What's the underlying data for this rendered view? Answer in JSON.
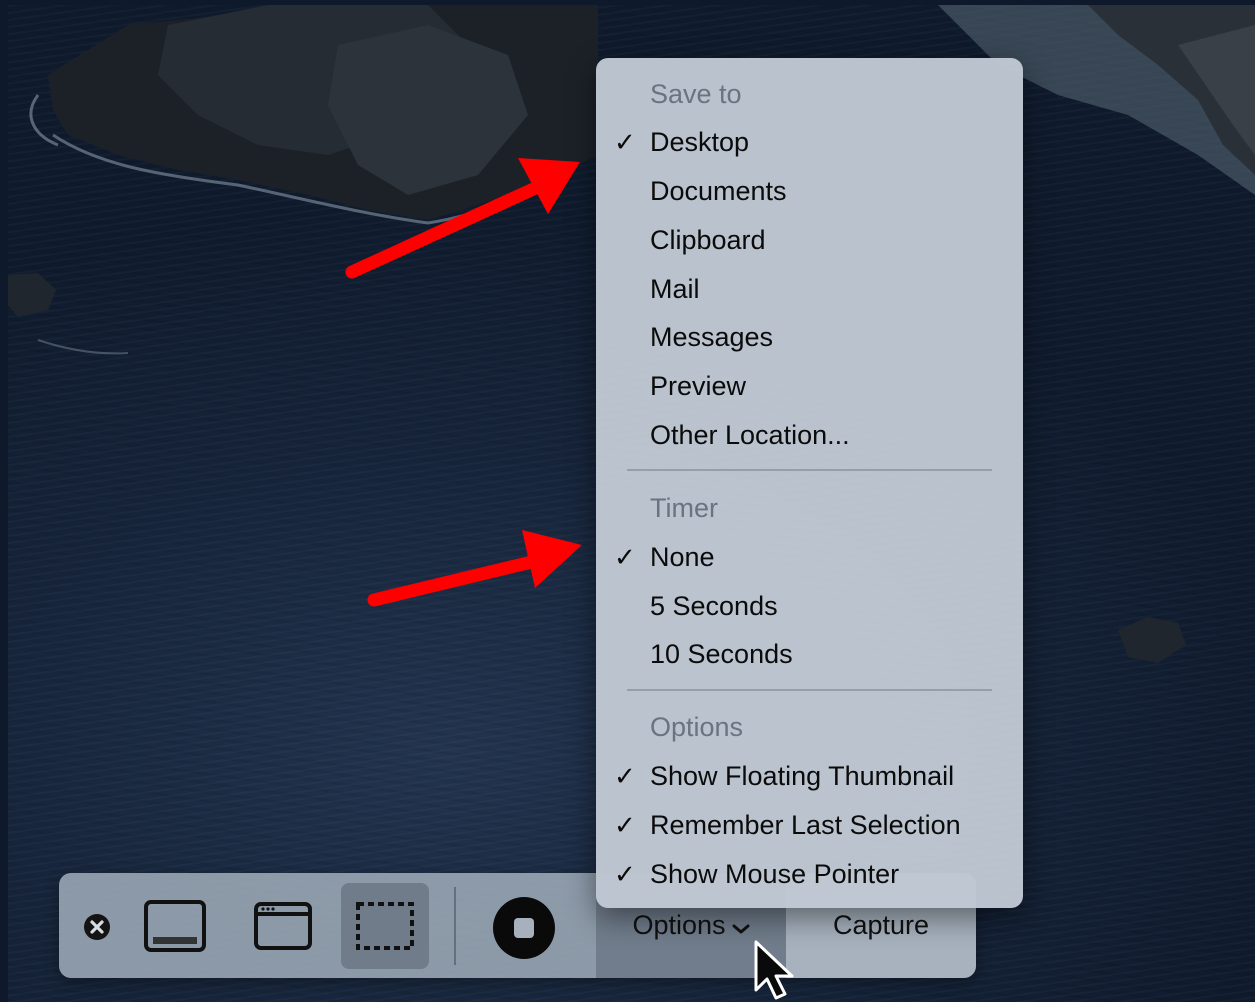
{
  "toolbar": {
    "close_icon": "close-icon",
    "capture_entire_screen_icon": "screen-icon",
    "capture_window_icon": "window-icon",
    "capture_selection_icon": "selection-icon",
    "record_icon": "record-stop-icon",
    "options_label": "Options",
    "capture_label": "Capture"
  },
  "menu": {
    "sections": [
      {
        "header": "Save to",
        "items": [
          {
            "label": "Desktop",
            "checked": true
          },
          {
            "label": "Documents",
            "checked": false
          },
          {
            "label": "Clipboard",
            "checked": false
          },
          {
            "label": "Mail",
            "checked": false
          },
          {
            "label": "Messages",
            "checked": false
          },
          {
            "label": "Preview",
            "checked": false
          },
          {
            "label": "Other Location...",
            "checked": false
          }
        ]
      },
      {
        "header": "Timer",
        "items": [
          {
            "label": "None",
            "checked": true
          },
          {
            "label": "5 Seconds",
            "checked": false
          },
          {
            "label": "10 Seconds",
            "checked": false
          }
        ]
      },
      {
        "header": "Options",
        "items": [
          {
            "label": "Show Floating Thumbnail",
            "checked": true
          },
          {
            "label": "Remember Last Selection",
            "checked": true
          },
          {
            "label": "Show Mouse Pointer",
            "checked": true
          }
        ]
      }
    ],
    "check_glyph": "✓"
  },
  "colors": {
    "annotation_arrow": "#ff0000",
    "menu_background": "#c0c8d3",
    "toolbar_background": "#96a2b0"
  }
}
